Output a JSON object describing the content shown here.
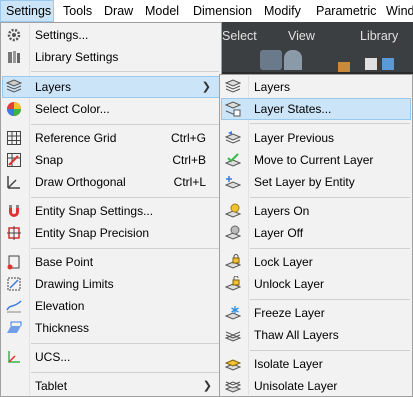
{
  "menubar": [
    "Settings",
    "Tools",
    "Draw",
    "Model",
    "Dimension",
    "Modify",
    "Parametric",
    "Wind"
  ],
  "tabs": [
    "Select",
    "View",
    "Library"
  ],
  "settings_menu": {
    "items": [
      {
        "label": "Settings...",
        "icon": "gear-icon"
      },
      {
        "label": "Library Settings",
        "icon": "library-icon"
      },
      {
        "label": "Layers",
        "icon": "layers-icon",
        "submenu": true
      },
      {
        "label": "Select Color...",
        "icon": "color-wheel-icon"
      },
      {
        "label": "Reference Grid",
        "icon": "grid-icon",
        "shortcut": "Ctrl+G"
      },
      {
        "label": "Snap",
        "icon": "snap-icon",
        "shortcut": "Ctrl+B"
      },
      {
        "label": "Draw Orthogonal",
        "icon": "ortho-icon",
        "shortcut": "Ctrl+L"
      },
      {
        "label": "Entity Snap Settings...",
        "icon": "magnet-icon"
      },
      {
        "label": "Entity Snap Precision",
        "icon": "snap-precision-icon"
      },
      {
        "label": "Base Point",
        "icon": "base-point-icon"
      },
      {
        "label": "Drawing Limits",
        "icon": "drawing-limits-icon"
      },
      {
        "label": "Elevation",
        "icon": "elevation-icon"
      },
      {
        "label": "Thickness",
        "icon": "thickness-icon"
      },
      {
        "label": "UCS...",
        "icon": "ucs-icon"
      },
      {
        "label": "Tablet",
        "submenu": true
      }
    ]
  },
  "layers_submenu": {
    "items": [
      {
        "label": "Layers",
        "icon": "layers-icon"
      },
      {
        "label": "Layer States...",
        "icon": "layer-states-icon"
      },
      {
        "label": "Layer Previous",
        "icon": "layer-previous-icon"
      },
      {
        "label": "Move to Current Layer",
        "icon": "move-to-layer-icon"
      },
      {
        "label": "Set Layer by Entity",
        "icon": "set-layer-icon"
      },
      {
        "label": "Layers On",
        "icon": "bulb-on-icon"
      },
      {
        "label": "Layer Off",
        "icon": "bulb-off-icon"
      },
      {
        "label": "Lock Layer",
        "icon": "lock-icon"
      },
      {
        "label": "Unlock Layer",
        "icon": "unlock-icon"
      },
      {
        "label": "Freeze Layer",
        "icon": "snowflake-icon"
      },
      {
        "label": "Thaw All Layers",
        "icon": "thaw-icon"
      },
      {
        "label": "Isolate Layer",
        "icon": "isolate-icon"
      },
      {
        "label": "Unisolate Layer",
        "icon": "unisolate-icon"
      }
    ]
  },
  "colors": {
    "highlight": "#cce4f7",
    "highlight_border": "#99c9ef",
    "menu_bg": "#f2f2f2"
  }
}
